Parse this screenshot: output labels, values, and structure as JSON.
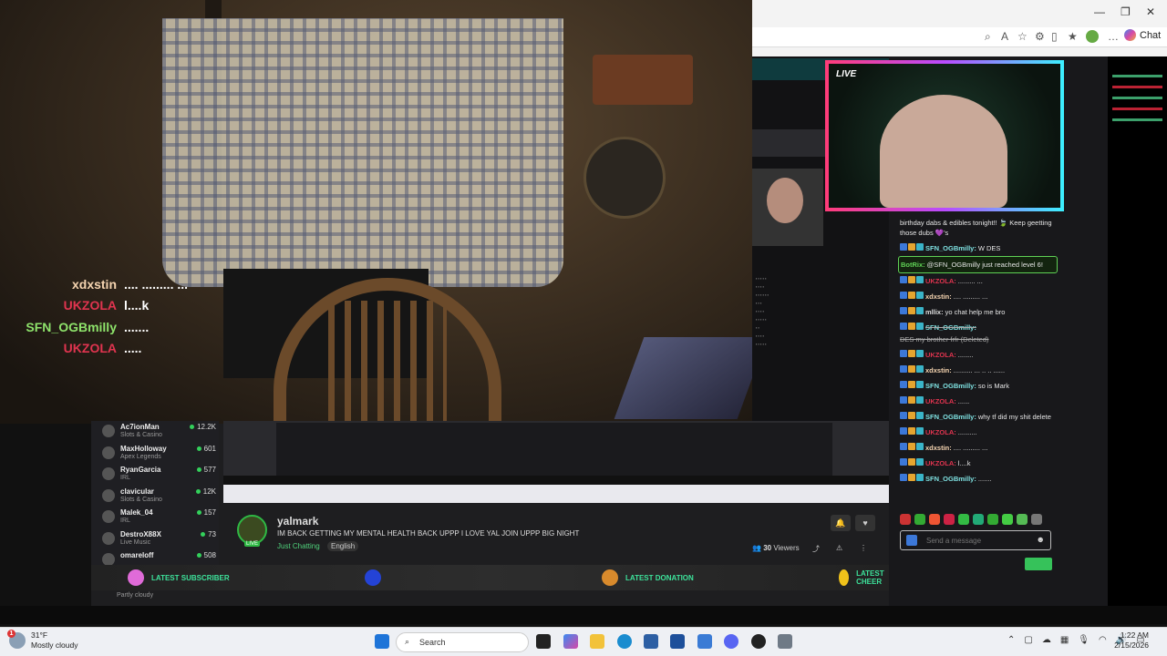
{
  "overlay_chat": [
    {
      "user": "xdxstin",
      "msg": ".... ......... ...",
      "color": "#f5d4b0"
    },
    {
      "user": "UKZOLA",
      "msg": "l....k",
      "color": "#e0344f"
    },
    {
      "user": "SFN_OGBmilly",
      "msg": ".......",
      "color": "#8ee36b"
    },
    {
      "user": "UKZOLA",
      "msg": ".....",
      "color": "#e0344f"
    }
  ],
  "browser": {
    "chat_label": "Chat"
  },
  "cam2_live": "LIVE",
  "side_chat": [
    {
      "user": "",
      "msg": "birthday dabs & edibles tonight!! 🍃 Keep geetting those dubs 💜's",
      "color": "#ddd",
      "type": "normal"
    },
    {
      "user": "SFN_OGBmilly:",
      "msg": "W DES",
      "color": "#7ee0e0",
      "type": "normal"
    },
    {
      "user": "BotRix:",
      "msg": "@SFN_OGBmilly just reached level 6!",
      "color": "#5fd155",
      "type": "bot"
    },
    {
      "user": "UKZOLA:",
      "msg": "......... ...",
      "color": "#e0344f",
      "type": "normal"
    },
    {
      "user": "xdxstin:",
      "msg": ".... ......... ...",
      "color": "#f5d4b0",
      "type": "normal"
    },
    {
      "user": "mllix:",
      "msg": "yo chat help me bro",
      "color": "#ddd",
      "type": "normal"
    },
    {
      "user": "SFN_OGBmilly:",
      "msg": "DES my brother frfr (Deleted)",
      "color": "#7ee0e0",
      "type": "del"
    },
    {
      "user": "UKZOLA:",
      "msg": "........",
      "color": "#e0344f",
      "type": "normal"
    },
    {
      "user": "xdxstin:",
      "msg": ".......... ... .. .. ......",
      "color": "#f5d4b0",
      "type": "normal"
    },
    {
      "user": "SFN_OGBmilly:",
      "msg": "so is Mark",
      "color": "#7ee0e0",
      "type": "normal"
    },
    {
      "user": "UKZOLA:",
      "msg": "......",
      "color": "#e0344f",
      "type": "normal"
    },
    {
      "user": "SFN_OGBmilly:",
      "msg": "why tf did my shit delete",
      "color": "#7ee0e0",
      "type": "normal"
    },
    {
      "user": "UKZOLA:",
      "msg": "..........",
      "color": "#e0344f",
      "type": "normal"
    },
    {
      "user": "xdxstin:",
      "msg": ".... ......... ...",
      "color": "#f5d4b0",
      "type": "normal"
    },
    {
      "user": "UKZOLA:",
      "msg": "l....k",
      "color": "#e0344f",
      "type": "normal"
    },
    {
      "user": "SFN_OGBmilly:",
      "msg": ".......",
      "color": "#7ee0e0",
      "type": "normal"
    }
  ],
  "send_placeholder": "Send a message",
  "sidebar": [
    {
      "name": "Ac7ionMan",
      "cat": "Slots & Casino",
      "viewers": "12.2K"
    },
    {
      "name": "MaxHolloway",
      "cat": "Apex Legends",
      "viewers": "601"
    },
    {
      "name": "RyanGarcia",
      "cat": "IRL",
      "viewers": "577"
    },
    {
      "name": "clavicular",
      "cat": "Slots & Casino",
      "viewers": "12K"
    },
    {
      "name": "Malek_04",
      "cat": "IRL",
      "viewers": "157"
    },
    {
      "name": "DestroX88X",
      "cat": "Live Music",
      "viewers": "73"
    },
    {
      "name": "omareloff",
      "cat": "",
      "viewers": "508"
    }
  ],
  "stream_info": {
    "channel": "yalmark",
    "title": "IM BACK GETTING MY MENTAL HEALTH BACK UPPP I LOVE YAL JOIN UPPP BIG NIGHT",
    "category": "Just Chatting",
    "language": "English",
    "live": "LIVE",
    "viewers_count": "30",
    "viewers_label": "Viewers"
  },
  "alerts": [
    {
      "label": "LATEST SUBSCRIBER",
      "value": "",
      "icon_color": "#e06bd8"
    },
    {
      "label": "",
      "value": "",
      "icon_color": "#2443d6"
    },
    {
      "label": "LATEST DONATION",
      "value": "",
      "icon_color": "#d88a2c"
    },
    {
      "label": "LATEST CHEER",
      "value": "",
      "icon_color": "#f0c21a"
    }
  ],
  "weather_small": "Partly cloudy",
  "taskbar": {
    "temp": "31°F",
    "condition": "Mostly cloudy",
    "notification_count": "1",
    "search": "Search",
    "time": "1:22 AM",
    "date": "2/15/2026"
  }
}
